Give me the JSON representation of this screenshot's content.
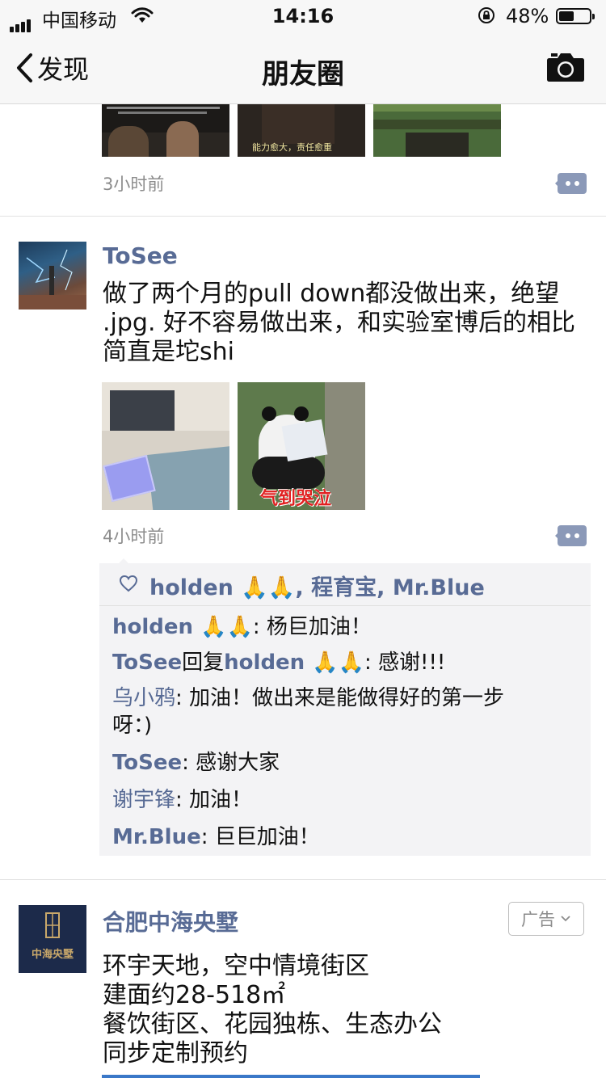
{
  "status_bar": {
    "carrier": "中国移动",
    "time": "14:16",
    "battery": "48%"
  },
  "nav": {
    "back_label": "发现",
    "title": "朋友圈"
  },
  "post_prev": {
    "thumb_captions": [
      "能力愈大，责任愈重"
    ],
    "time": "3小时前"
  },
  "post_tosee": {
    "author": "ToSee",
    "text_lines": [
      "做了两个月的pull down都没做出来，绝望",
      ".jpg. 好不容易做出来，和实验室博后的相比",
      "简直是坨shi"
    ],
    "image2_caption": "气到哭泣",
    "time": "4小时前",
    "likes": "holden 🙏🙏, 程育宝, Mr.Blue",
    "comments": [
      {
        "author": "holden 🙏🙏",
        "text": ": 杨巨加油！"
      },
      {
        "author": "ToSee",
        "reply_word": "回复",
        "reply_to": "holden 🙏🙏",
        "text": ": 感谢!!!"
      },
      {
        "author": "乌小鸦",
        "text": ": 加油！做出来是能做得好的第一步",
        "text2": "呀：)"
      },
      {
        "author": "ToSee",
        "text": ": 感谢大家"
      },
      {
        "author": "谢宇锋",
        "text": ": 加油！"
      },
      {
        "author": "Mr.Blue",
        "text": ": 巨巨加油！"
      }
    ]
  },
  "post_ad": {
    "author": "合肥中海央墅",
    "ad_label": "广告",
    "logo_text": "中海央墅",
    "lines": [
      "环宇天地，空中情境街区",
      "建面约28-518㎡",
      "餐饮街区、花园独栋、生态办公",
      "同步定制预约"
    ]
  }
}
